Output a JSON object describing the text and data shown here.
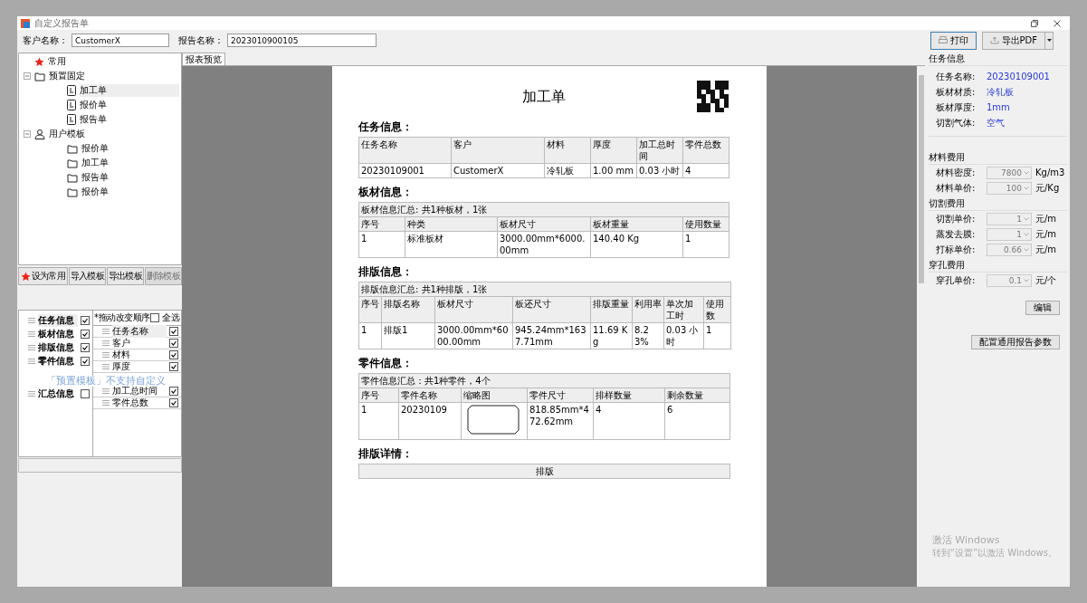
{
  "window": {
    "title": "自定义报告单"
  },
  "toolbar": {
    "fields": [
      {
        "label": "客户名称：",
        "value": "CustomerX"
      },
      {
        "label": "报告名称：",
        "value": "2023010900105"
      }
    ],
    "buttons": [
      {
        "label": "打印",
        "kind": "print",
        "focused": true
      },
      {
        "label": "导出PDF",
        "kind": "export",
        "focused": false
      }
    ]
  },
  "tree": [
    {
      "label": "常用",
      "kind": "favorite",
      "selected": false
    },
    {
      "label": "预置固定",
      "kind": "folder",
      "selected": false,
      "expanded": true,
      "children": [
        {
          "label": "加工单",
          "kind": "document",
          "selected": true
        },
        {
          "label": "报价单",
          "kind": "document",
          "selected": false
        },
        {
          "label": "报告单",
          "kind": "document",
          "selected": false
        }
      ]
    },
    {
      "label": "用户模板",
      "kind": "user",
      "selected": false,
      "expanded": true,
      "children": [
        {
          "label": "报价单",
          "kind": "folder",
          "selected": false
        },
        {
          "label": "加工单",
          "kind": "folder",
          "selected": false
        },
        {
          "label": "报告单",
          "kind": "folder",
          "selected": false
        },
        {
          "label": "报价单",
          "kind": "folder",
          "selected": false
        }
      ]
    }
  ],
  "template_buttons": [
    {
      "label": "设为常用",
      "star": true,
      "disabled": false
    },
    {
      "label": "导入模板",
      "disabled": false
    },
    {
      "label": "导出模板",
      "disabled": false
    },
    {
      "label": "删除模板",
      "disabled": true
    }
  ],
  "sections_list": [
    {
      "label": "任务信息",
      "checked": true,
      "selected": true
    },
    {
      "label": "板材信息",
      "checked": true,
      "selected": false
    },
    {
      "label": "排版信息",
      "checked": true,
      "selected": false
    },
    {
      "label": "零件信息",
      "checked": true,
      "selected": false
    },
    {
      "label": "汇总信息",
      "checked": false,
      "selected": false
    }
  ],
  "fields_list": {
    "hint": "*拖动改变顺序",
    "select_all": {
      "label": "全选",
      "checked": false
    },
    "items": [
      {
        "label": "任务名称",
        "checked": true,
        "selected": true
      },
      {
        "label": "客户",
        "checked": true,
        "selected": false
      },
      {
        "label": "材料",
        "checked": true,
        "selected": false
      },
      {
        "label": "厚度",
        "checked": true,
        "selected": false
      },
      {
        "label": "加工总时间",
        "checked": true,
        "selected": false
      },
      {
        "label": "零件总数",
        "checked": true,
        "selected": false
      }
    ]
  },
  "toast": "「预置模板」不支持自定义",
  "preview_tab": {
    "label": "报表预览",
    "selected": true
  },
  "report": {
    "title": "加工单",
    "sections": [
      {
        "heading": "任务信息：",
        "columns": [
          "任务名称",
          "客户",
          "材料",
          "厚度",
          "加工总时间",
          "零件总数"
        ],
        "rows": [
          [
            "20230109001",
            "CustomerX",
            "冷轧板",
            "1.00 mm",
            "0.03 小时",
            "4"
          ]
        ]
      },
      {
        "heading": "板材信息：",
        "summary": "板材信息汇总: 共1种板材，1张",
        "columns": [
          "序号",
          "种类",
          "板材尺寸",
          "板材重量",
          "使用数量"
        ],
        "rows": [
          [
            "1",
            "标准板材",
            "3000.00mm*6000.00mm",
            "140.40 Kg",
            "1"
          ]
        ]
      },
      {
        "heading": "排版信息：",
        "summary": "排版信息汇总: 共1种排版，1张",
        "columns": [
          "序号",
          "排版名称",
          "板材尺寸",
          "板还尺寸",
          "排版重量",
          "利用率",
          "单次加工时",
          "使用数"
        ],
        "rows": [
          [
            "1",
            "排版1",
            "3000.00mm*6000.00mm",
            "945.24mm*1637.71mm",
            "11.69 Kg",
            "8.23%",
            "0.03 小时",
            "1"
          ]
        ]
      },
      {
        "heading": "零件信息：",
        "summary": "零件信息汇总：共1种零件，4个",
        "columns": [
          "序号",
          "零件名称",
          "缩略图",
          "零件尺寸",
          "排样数量",
          "剩余数量"
        ],
        "rows": [
          [
            "1",
            "20230109",
            {
              "kind": "thumbnail"
            },
            "818.85mm*472.62mm",
            "4",
            "6"
          ]
        ]
      },
      {
        "heading": "排版详情：",
        "columns": [
          "排版"
        ]
      }
    ]
  },
  "side": {
    "task_title": "任务信息",
    "task": [
      {
        "label": "任务名称:",
        "value": "20230109001"
      },
      {
        "label": "板材材质:",
        "value": "冷轧板"
      },
      {
        "label": "板材厚度:",
        "value": "1mm"
      },
      {
        "label": "切割气体:",
        "value": "空气"
      }
    ],
    "groups": [
      {
        "title": "材料费用",
        "rows": [
          {
            "label": "材料密度:",
            "value": "7800",
            "unit": "Kg/m3"
          },
          {
            "label": "材料单价:",
            "value": "100",
            "unit": "元/Kg"
          }
        ]
      },
      {
        "title": "切割费用",
        "rows": [
          {
            "label": "切割单价:",
            "value": "1",
            "unit": "元/m"
          },
          {
            "label": "蒸发去膜:",
            "value": "1",
            "unit": "元/m"
          },
          {
            "label": "打标单价:",
            "value": "0.66",
            "unit": "元/m"
          }
        ]
      },
      {
        "title": "穿孔费用",
        "rows": [
          {
            "label": "穿孔单价:",
            "value": "0.1",
            "unit": "元/个"
          }
        ]
      }
    ],
    "edit_button": "编辑",
    "config_button": "配置通用报告参数"
  },
  "system_watermark": [
    "激活 Windows",
    "转到“设置”以激活 Windows。"
  ]
}
